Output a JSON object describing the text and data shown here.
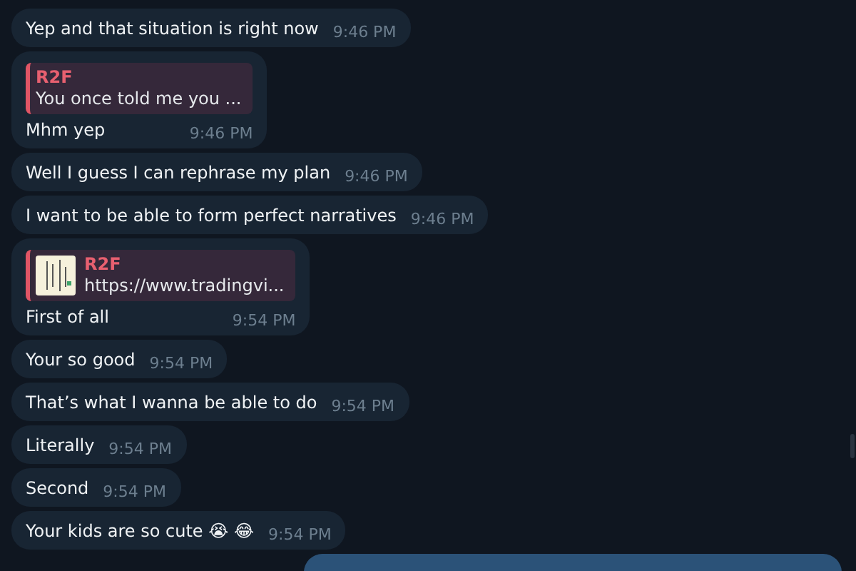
{
  "messages": [
    {
      "kind": "text",
      "text": "Yep and that situation is right now",
      "time": "9:46 PM"
    },
    {
      "kind": "reply",
      "quote": {
        "author": "R2F",
        "text": "You once told me you ...",
        "thumbnail": false
      },
      "text": "Mhm yep",
      "time": "9:46 PM"
    },
    {
      "kind": "text",
      "text": "Well I guess I can rephrase my plan",
      "time": "9:46 PM"
    },
    {
      "kind": "text",
      "text": "I want to be able to form perfect narratives",
      "time": "9:46 PM"
    },
    {
      "kind": "reply",
      "quote": {
        "author": "R2F",
        "text": "https://www.tradingvi...",
        "thumbnail": true
      },
      "text": "First of all",
      "time": "9:54 PM"
    },
    {
      "kind": "text",
      "text": "Your so good",
      "time": "9:54 PM"
    },
    {
      "kind": "text",
      "text": "That’s what I wanna be able to do",
      "time": "9:54 PM"
    },
    {
      "kind": "text",
      "text": "Literally",
      "time": "9:54 PM"
    },
    {
      "kind": "text",
      "text": "Second",
      "time": "9:54 PM"
    },
    {
      "kind": "text",
      "text": "Your kids are so cute 😭 😂",
      "time": "9:54 PM"
    }
  ]
}
